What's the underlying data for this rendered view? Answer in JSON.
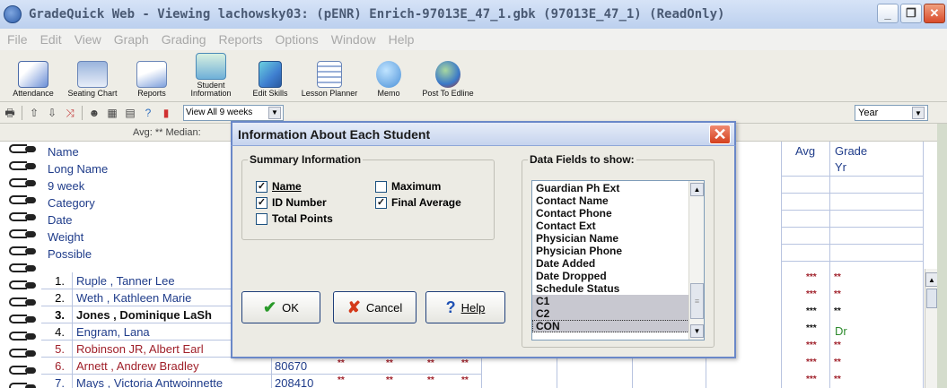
{
  "window": {
    "title": "GradeQuick Web - Viewing lachowsky03:  (pENR) Enrich-97013E_47_1.gbk (97013E_47_1) (ReadOnly)"
  },
  "menu": [
    "File",
    "Edit",
    "View",
    "Graph",
    "Grading",
    "Reports",
    "Options",
    "Window",
    "Help"
  ],
  "toolbar": {
    "buttons": [
      {
        "label": "Attendance",
        "icon": "calendar-icon",
        "color": "#6b8fd6"
      },
      {
        "label": "Seating Chart",
        "icon": "seating-chart-icon",
        "color": "#8aa6d4"
      },
      {
        "label": "Reports",
        "icon": "reports-icon",
        "color": "#7ea0dc"
      },
      {
        "label": "Student Information",
        "icon": "student-info-icon",
        "color": "#6fb0d8"
      },
      {
        "label": "Edit Skills",
        "icon": "skills-cube-icon",
        "color": "#3f7fd0"
      },
      {
        "label": "Lesson Planner",
        "icon": "lesson-planner-icon",
        "color": "#9ab0d8"
      },
      {
        "label": "Memo",
        "icon": "memo-icon",
        "color": "#4a90d8"
      },
      {
        "label": "Post To Edline",
        "icon": "edline-globe-icon",
        "color": "#3a78c8"
      }
    ]
  },
  "subtoolbar": {
    "view_select": "View All 9 weeks",
    "year_select": "Year"
  },
  "grid": {
    "avg_text": "Avg: **  Median:",
    "header_labels": [
      "Name",
      "Long Name",
      "9 week",
      "Category",
      "Date",
      "Weight",
      "Possible"
    ],
    "right_headers": {
      "avg": "Avg",
      "grade": "Grade",
      "grade_sub": "Yr"
    },
    "students": [
      {
        "num": "1.",
        "name": "Ruple , Tanner Lee",
        "id": "",
        "name_color": "#1f3c8a",
        "bold": false,
        "grade": "**"
      },
      {
        "num": "2.",
        "name": "Weth , Kathleen Marie",
        "id": "",
        "name_color": "#1f3c8a",
        "bold": false,
        "grade": "**"
      },
      {
        "num": "3.",
        "name": "Jones , Dominique LaSh",
        "id": "",
        "name_color": "#111111",
        "bold": true,
        "grade": "**"
      },
      {
        "num": "4.",
        "name": "Engram, Lana",
        "id": "",
        "name_color": "#1f3c8a",
        "bold": false,
        "grade": "Dr"
      },
      {
        "num": "5.",
        "name": "Robinson JR, Albert Earl",
        "id": "",
        "name_color": "#a0202a",
        "bold": false,
        "grade": "**"
      },
      {
        "num": "6.",
        "name": "Arnett , Andrew Bradley",
        "id": "80670",
        "name_color": "#a0202a",
        "bold": false,
        "grade": "**"
      },
      {
        "num": "7.",
        "name": "Mays , Victoria Antwoinnette",
        "id": "208410",
        "name_color": "#1f3c8a",
        "bold": false,
        "grade": "**"
      }
    ],
    "avg_stars": "***",
    "score_stars": "**"
  },
  "dialog": {
    "title": "Information About Each Student",
    "summary_group": "Summary Information",
    "checkboxes": [
      {
        "label": "Name",
        "checked": true
      },
      {
        "label": "ID Number",
        "checked": true
      },
      {
        "label": "Total Points",
        "checked": false
      },
      {
        "label": "Maximum",
        "checked": false
      },
      {
        "label": "Final Average",
        "checked": true
      }
    ],
    "fields_group": "Data Fields to show:",
    "fields": [
      "Guardian Ph Ext",
      "Contact Name",
      "Contact Phone",
      "Contact Ext",
      "Physician Name",
      "Physician Phone",
      "Date Added",
      "Date Dropped",
      "Schedule Status",
      "C1",
      "C2",
      "CON"
    ],
    "buttons": {
      "ok": "OK",
      "cancel": "Cancel",
      "help": "Help"
    }
  }
}
